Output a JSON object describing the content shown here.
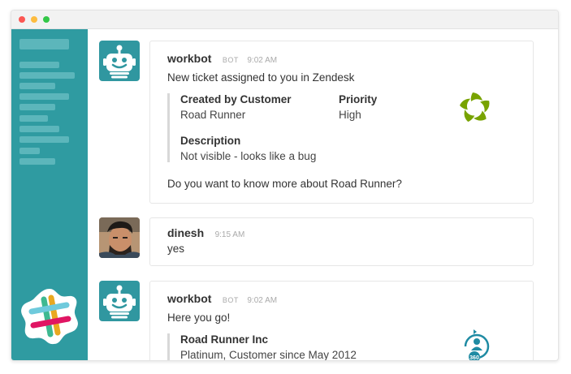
{
  "messages": [
    {
      "author": "workbot",
      "badge": "BOT",
      "time": "9:02 AM",
      "text": "New ticket assigned to you in Zendesk",
      "fields": [
        {
          "label": "Created by Customer",
          "value": "Road Runner"
        },
        {
          "label": "Priority",
          "value": "High"
        },
        {
          "label": "Description",
          "value": "Not visible - looks like a bug"
        }
      ],
      "followup": "Do you want to know more about Road Runner?",
      "attachment_icon": "zendesk-icon"
    },
    {
      "author": "dinesh",
      "time": "9:15 AM",
      "text": "yes"
    },
    {
      "author": "workbot",
      "badge": "BOT",
      "time": "9:02 AM",
      "text": "Here you go!",
      "fields": [
        {
          "label": "Road Runner Inc",
          "value": "Platinum, Customer since May 2012"
        }
      ],
      "attachment_icon": "customer-360-icon",
      "attachment_icon_text": "360"
    }
  ],
  "colors": {
    "sidebar": "#2f9ba1",
    "zendesk_green": "#78a300",
    "icon_360": "#1f8ba3"
  }
}
